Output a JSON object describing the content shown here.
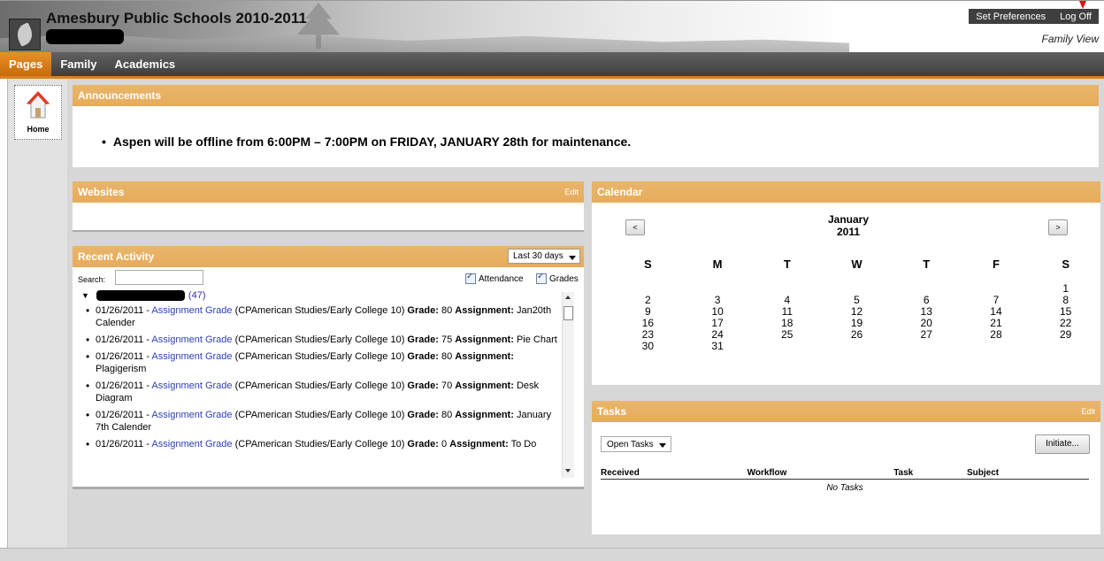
{
  "header": {
    "school_name": "Amesbury Public Schools 2010-2011",
    "set_preferences": "Set Preferences",
    "log_off": "Log Off",
    "view_label": "Family View"
  },
  "nav": {
    "tabs": [
      {
        "label": "Pages",
        "active": true
      },
      {
        "label": "Family",
        "active": false
      },
      {
        "label": "Academics",
        "active": false
      }
    ]
  },
  "sidebar": {
    "home_label": "Home",
    "home_icon": "house-icon"
  },
  "announcements": {
    "title": "Announcements",
    "items": [
      "Aspen will be offline from 6:00PM – 7:00PM on FRIDAY, JANUARY 28th for maintenance."
    ]
  },
  "websites": {
    "title": "Websites",
    "edit": "Edit"
  },
  "recent_activity": {
    "title": "Recent Activity",
    "range": "Last 30 days",
    "search_label": "Search:",
    "search_value": "",
    "attendance_label": "Attendance",
    "grades_label": "Grades",
    "attendance_checked": true,
    "grades_checked": true,
    "student_count": "(47)",
    "items": [
      {
        "date": "01/26/2011 -",
        "type": "Assignment Grade",
        "course": "(CPAmerican Studies/Early College 10)",
        "grade_label": "Grade:",
        "grade": "80",
        "assignment_label": "Assignment:",
        "assignment": "Jan20th Calender"
      },
      {
        "date": "01/26/2011 -",
        "type": "Assignment Grade",
        "course": "(CPAmerican Studies/Early College 10)",
        "grade_label": "Grade:",
        "grade": "75",
        "assignment_label": "Assignment:",
        "assignment": "Pie Chart"
      },
      {
        "date": "01/26/2011 -",
        "type": "Assignment Grade",
        "course": "(CPAmerican Studies/Early College 10)",
        "grade_label": "Grade:",
        "grade": "80",
        "assignment_label": "Assignment:",
        "assignment": "Plagigerism"
      },
      {
        "date": "01/26/2011 -",
        "type": "Assignment Grade",
        "course": "(CPAmerican Studies/Early College 10)",
        "grade_label": "Grade:",
        "grade": "70",
        "assignment_label": "Assignment:",
        "assignment": "Desk Diagram"
      },
      {
        "date": "01/26/2011 -",
        "type": "Assignment Grade",
        "course": "(CPAmerican Studies/Early College 10)",
        "grade_label": "Grade:",
        "grade": "80",
        "assignment_label": "Assignment:",
        "assignment": "January 7th Calender"
      },
      {
        "date": "01/26/2011 -",
        "type": "Assignment Grade",
        "course": "(CPAmerican Studies/Early College 10)",
        "grade_label": "Grade:",
        "grade": "0",
        "assignment_label": "Assignment:",
        "assignment": "To Do"
      }
    ]
  },
  "calendar": {
    "title": "Calendar",
    "prev": "<",
    "next": ">",
    "month": "January",
    "year": "2011",
    "weekdays": [
      "S",
      "M",
      "T",
      "W",
      "T",
      "F",
      "S"
    ],
    "weeks": [
      [
        "",
        "",
        "",
        "",
        "",
        "",
        "1"
      ],
      [
        "2",
        "3",
        "4",
        "5",
        "6",
        "7",
        "8"
      ],
      [
        "9",
        "10",
        "11",
        "12",
        "13",
        "14",
        "15"
      ],
      [
        "16",
        "17",
        "18",
        "19",
        "20",
        "21",
        "22"
      ],
      [
        "23",
        "24",
        "25",
        "26",
        "27",
        "28",
        "29"
      ],
      [
        "30",
        "31",
        "",
        "",
        "",
        "",
        ""
      ]
    ]
  },
  "tasks": {
    "title": "Tasks",
    "edit": "Edit",
    "filter": "Open Tasks",
    "initiate": "Initiate...",
    "columns": [
      "Received",
      "Workflow",
      "Task",
      "Subject"
    ],
    "empty": "No Tasks"
  },
  "colors": {
    "panel_header": "#e8b064",
    "nav_active": "#d97a14",
    "nav_bar": "#4a4a4a",
    "link": "#2d3fb0"
  }
}
